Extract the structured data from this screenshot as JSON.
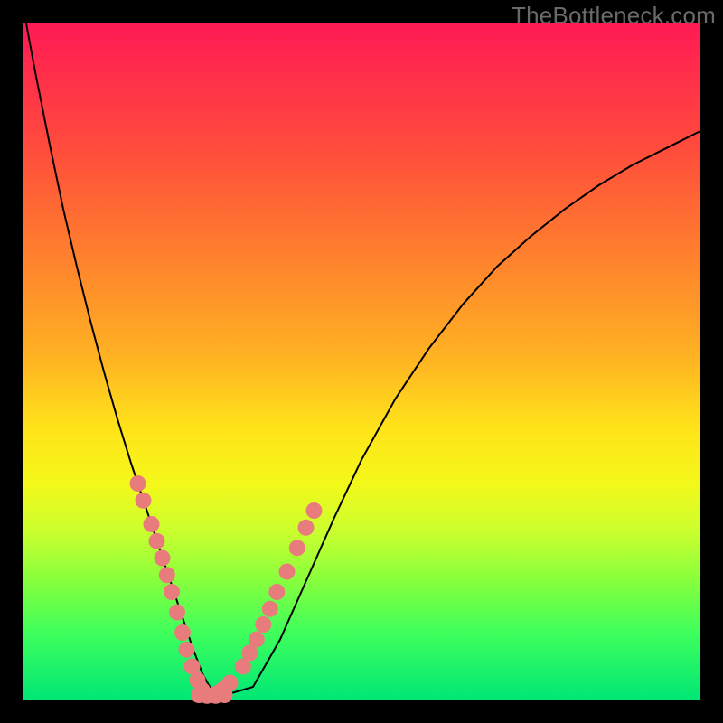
{
  "watermark": "TheBottleneck.com",
  "chart_data": {
    "type": "line",
    "title": "",
    "xlabel": "",
    "ylabel": "",
    "xlim": [
      0,
      100
    ],
    "ylim": [
      0,
      100
    ],
    "grid": false,
    "legend": false,
    "background": "rainbow-gradient-red-to-green",
    "series": [
      {
        "name": "bottleneck-curve",
        "kind": "line",
        "x": [
          0.5,
          2,
          4,
          6,
          8,
          10,
          12,
          14,
          16,
          18,
          20,
          22,
          23.5,
          25,
          26.5,
          28,
          29.5,
          34,
          38,
          42,
          46,
          50,
          55,
          60,
          65,
          70,
          75,
          80,
          85,
          90,
          95,
          100
        ],
        "y": [
          100,
          92,
          82,
          72.5,
          64,
          56,
          48.5,
          41.5,
          35,
          29,
          23,
          17,
          12.5,
          8,
          4,
          1.3,
          0.7,
          2,
          9,
          18,
          27,
          35.5,
          44.5,
          52,
          58.5,
          64,
          68.5,
          72.5,
          76,
          79,
          81.5,
          84
        ]
      },
      {
        "name": "left-branch-dots",
        "kind": "scatter",
        "x": [
          17.0,
          17.8,
          19.0,
          19.8,
          20.6,
          21.3,
          22.0,
          22.8,
          23.6,
          24.2,
          25.0,
          25.8,
          26.5,
          27.0
        ],
        "y": [
          32.0,
          29.5,
          26.0,
          23.5,
          21.0,
          18.5,
          16.0,
          13.0,
          10.0,
          7.5,
          5.0,
          3.0,
          1.5,
          0.8
        ]
      },
      {
        "name": "right-branch-dots",
        "kind": "scatter",
        "x": [
          28.2,
          29.0,
          29.8,
          30.6,
          32.5,
          33.5,
          34.5,
          35.5,
          36.5,
          37.5,
          39.0,
          40.5,
          41.8,
          43.0
        ],
        "y": [
          0.8,
          1.2,
          1.8,
          2.6,
          5.0,
          7.0,
          9.0,
          11.2,
          13.5,
          16.0,
          19.0,
          22.5,
          25.5,
          28.0
        ]
      },
      {
        "name": "bottom-dots",
        "kind": "scatter",
        "x": [
          26.0,
          27.2,
          28.5,
          29.8
        ],
        "y": [
          0.8,
          0.7,
          0.7,
          0.8
        ]
      }
    ],
    "annotations": [
      {
        "text": "TheBottleneck.com",
        "pos": "top-right",
        "role": "watermark"
      }
    ]
  }
}
